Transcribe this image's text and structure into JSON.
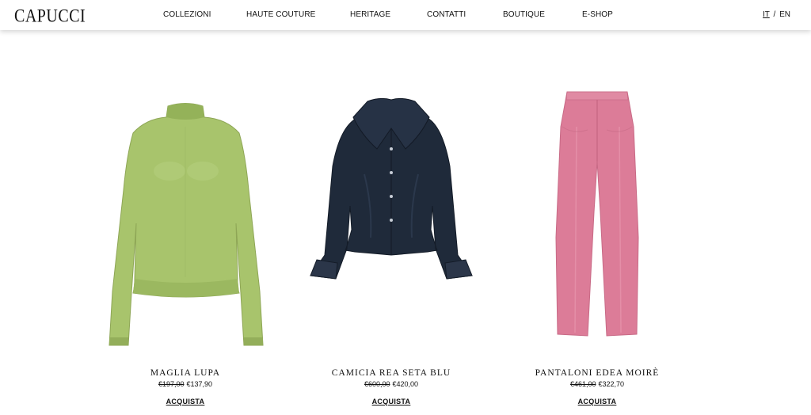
{
  "brand": {
    "logo": "CAPUCCI"
  },
  "nav": {
    "items": [
      "COLLEZIONI",
      "HAUTE COUTURE",
      "HERITAGE",
      "CONTATTI",
      "BOUTIQUE",
      "E-SHOP"
    ]
  },
  "lang": {
    "it": "IT",
    "sep": "/",
    "en": "EN",
    "active": "IT"
  },
  "products": [
    {
      "name": "MAGLIA LUPA",
      "old_price": "€197,00",
      "price": "€137,90",
      "cta": "ACQUISTA",
      "color": "#a7c36b"
    },
    {
      "name": "CAMICIA REA SETA BLU",
      "old_price": "€600,00",
      "price": "€420,00",
      "cta": "ACQUISTA",
      "color": "#1e2838"
    },
    {
      "name": "PANTALONI EDEA MOIRÈ",
      "old_price": "€461,00",
      "price": "€322,70",
      "cta": "ACQUISTA",
      "color": "#db7b97"
    }
  ]
}
